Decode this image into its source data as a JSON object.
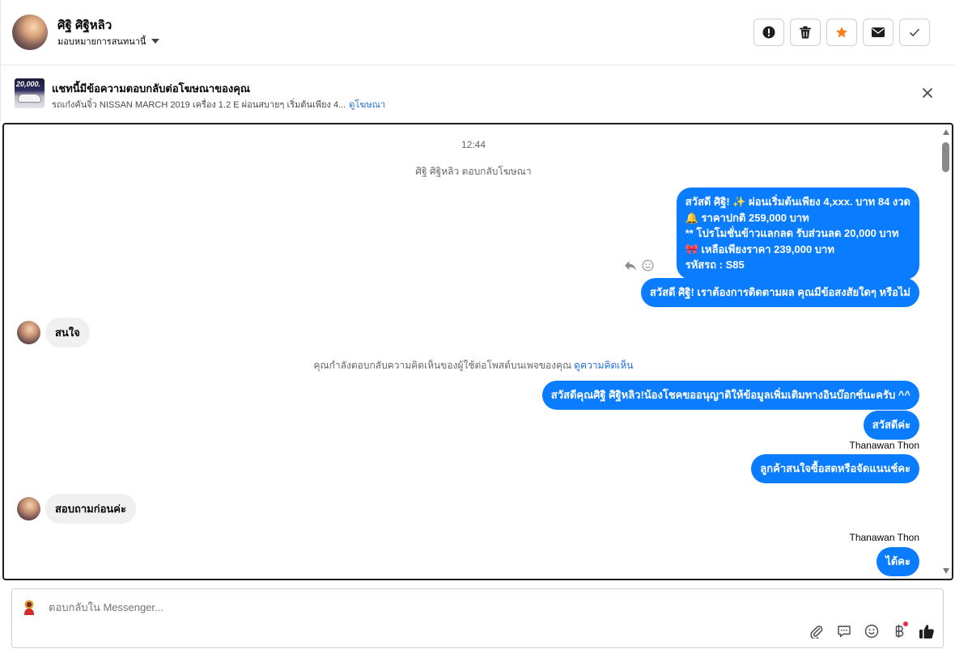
{
  "header": {
    "name": "ศิฐิ ศิฐิหลิว",
    "assign_label": "มอบหมายการสนทนานี้",
    "buttons": [
      "spam",
      "delete",
      "star",
      "mark-unread",
      "done"
    ]
  },
  "ad": {
    "title": "แชทนี้มีข้อความตอบกลับต่อโฆษณาของคุณ",
    "thumb_badge": "20,000.",
    "description": "รถเก๋งคันจิ๋ว NISSAN MARCH 2019 เครื่อง 1.2 E ผ่อนสบายๆ เริ่มต้นเพียง 4...",
    "link": "ดูโฆษณา"
  },
  "chat": {
    "timestamp": "12:44",
    "ad_reply_note": "ศิฐิ ศิฐิหลิว ตอบกลับโฆษณา",
    "promo_lines": [
      "สวัสดี ศิฐิ! ✨  ผ่อนเริ่มต้นเพียง 4,xxx. บาท 84 งวด",
      "🔔 ราคาปกติ 259,000 บาท",
      "** โปรโมชั่นข้าวแลกลด รับส่วนลด 20,000 บาท",
      "🎀  เหลือเพียงราคา 239,000 บาท",
      " รหัสรถ : S85"
    ],
    "followup": "สวัสดี ศิฐิ! เราต้องการติดตามผล คุณมีข้อสงสัยใดๆ หรือไม่",
    "in_1": "สนใจ",
    "comment_notice": "คุณกำลังตอบกลับความคิดเห็นของผู้ใช้ต่อโพสต์บนเพจของคุณ",
    "comment_link": "ดูความคิดเห็น",
    "out_2": "สวัสดีคุณศิฐิ ศิฐิหลิว!น้องโชคขออนุญาติให้ข้อมูลเพิ่มเติมทางอินบ๊อกซ์นะครับ ^^",
    "out_3": "สวัสดีค่ะ",
    "sender_1": "Thanawan Thon",
    "out_4": "ลูกค้าสนใจซื้อสดหรือจัดแนนช์คะ",
    "in_2": "สอบถามก่อนค่ะ",
    "sender_2": "Thanawan Thon",
    "out_5": "ได้คะ"
  },
  "composer": {
    "placeholder": "ตอบกลับใน Messenger...",
    "tools": [
      "attach",
      "saved-reply",
      "emoji",
      "payment",
      "like"
    ]
  },
  "colors": {
    "accent": "#0a7cff",
    "link": "#216fdb",
    "star": "#f5821f"
  }
}
